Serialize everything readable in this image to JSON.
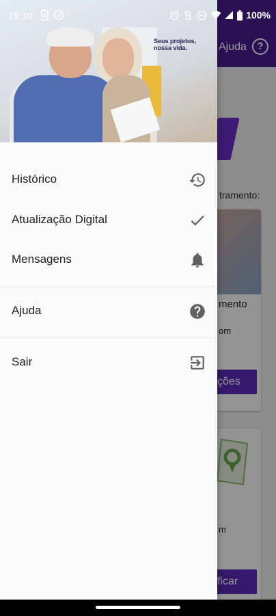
{
  "status_bar": {
    "time": "19:10",
    "battery": "100%",
    "left_icons": [
      "sim-icon",
      "check-circle-icon"
    ],
    "right_icons": [
      "alarm-icon",
      "vibrate-off-icon",
      "dnd-icon",
      "wifi-icon",
      "signal-icon",
      "battery-icon"
    ]
  },
  "drawer": {
    "banner": {
      "tagline": "Seus projetos, nossa vida."
    },
    "items": [
      {
        "label": "Histórico",
        "icon": "history-icon"
      },
      {
        "label": "Atualização Digital",
        "icon": "check-icon"
      },
      {
        "label": "Mensagens",
        "icon": "bell-icon"
      },
      {
        "label": "Ajuda",
        "icon": "help-icon"
      },
      {
        "label": "Sair",
        "icon": "exit-icon"
      }
    ]
  },
  "background": {
    "header_help_label": "Ajuda",
    "help_glyph": "?",
    "hint_fragment": "tramento:",
    "card1": {
      "title_fragment": "mento",
      "line_fragment": "om",
      "button_fragment": "ções"
    },
    "card2": {
      "line_fragment": "m",
      "button_fragment": "ficar"
    }
  },
  "colors": {
    "brand_purple": "#4b1d95",
    "button_purple": "#5b2ab8",
    "drawer_bg": "#fafafa",
    "icon_gray": "#616161"
  }
}
